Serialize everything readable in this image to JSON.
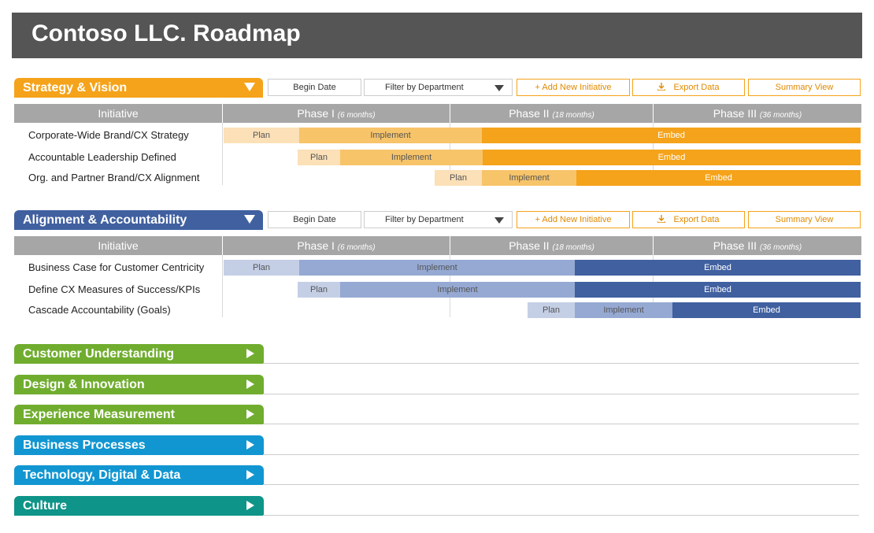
{
  "app": {
    "title": "Contoso LLC. Roadmap"
  },
  "controls": {
    "begin_date": "Begin Date",
    "filter": "Filter by Department",
    "add": "+ Add New Initiative",
    "export": "Export Data",
    "summary": "Summary View"
  },
  "table_header": {
    "initiative": "Initiative",
    "phase1": "Phase I",
    "phase1_dur": "(6 months)",
    "phase2": "Phase II",
    "phase2_dur": "(18 months)",
    "phase3": "Phase III",
    "phase3_dur": "(36 months)"
  },
  "colors": {
    "orange_dark": "#f5a31a",
    "orange_mid": "#f7c46a",
    "orange_light": "#fbe0b8",
    "blue_dark": "#4060a0",
    "blue_mid": "#95a9d3",
    "blue_light": "#c4cfe6",
    "green": "#70ad2f",
    "cyan": "#1196d1",
    "teal": "#0e9488"
  },
  "sections": [
    {
      "title": "Strategy & Vision",
      "rows": [
        {
          "label": "Corporate-Wide Brand/CX Strategy",
          "plan": "Plan",
          "implement": "Implement",
          "embed": "Embed"
        },
        {
          "label": "Accountable Leadership Defined",
          "plan": "Plan",
          "implement": "Implement",
          "embed": "Embed"
        },
        {
          "label": "Org. and Partner Brand/CX Alignment",
          "plan": "Plan",
          "implement": "Implement",
          "embed": "Embed"
        }
      ]
    },
    {
      "title": "Alignment & Accountability",
      "rows": [
        {
          "label": "Business Case for Customer Centricity",
          "plan": "Plan",
          "implement": "Implement",
          "embed": "Embed"
        },
        {
          "label": "Define CX Measures of Success/KPIs",
          "plan": "Plan",
          "implement": "Implement",
          "embed": "Embed"
        },
        {
          "label": "Cascade Accountability (Goals)",
          "plan": "Plan",
          "implement": "Implement",
          "embed": "Embed"
        }
      ]
    }
  ],
  "collapsed_sections": [
    "Customer Understanding",
    "Design & Innovation",
    "Experience Measurement",
    "Business Processes",
    "Technology, Digital & Data",
    "Culture"
  ]
}
